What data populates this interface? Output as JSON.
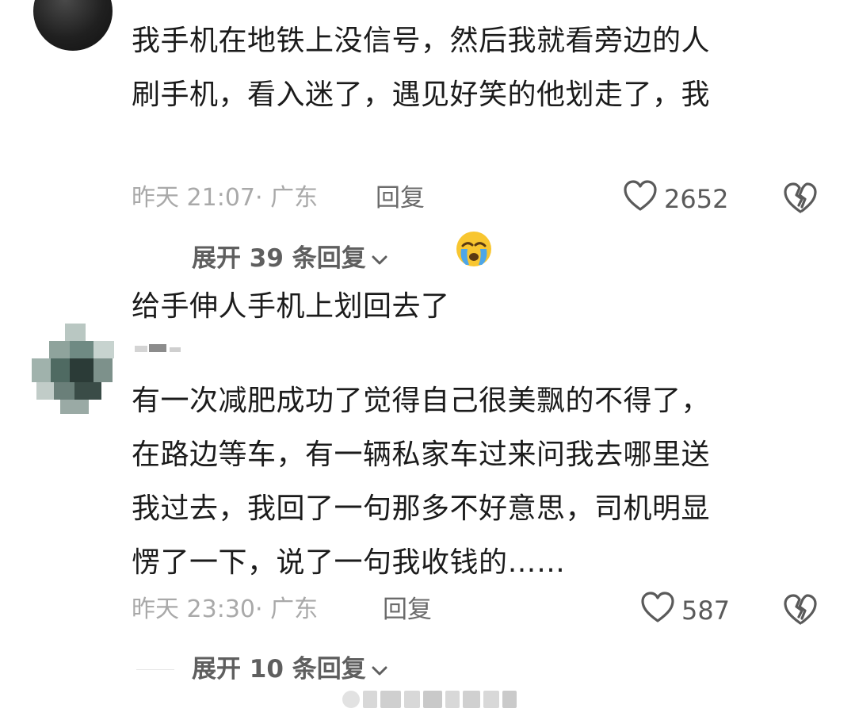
{
  "comments": [
    {
      "text": "我手机在地铁上没信号，然后我就看旁边的人\n刷手机，看入迷了，遇见好笑的他划走了，我\n给手伸人手机上划回去了",
      "emoji": "crying-face",
      "time": "昨天 21:07·",
      "location": "广东",
      "reply_label": "回复",
      "likes": "2652",
      "expand_label": "展开 39 条回复"
    },
    {
      "text": "有一次减肥成功了觉得自己很美飘的不得了，\n在路边等车，有一辆私家车过来问我去哪里送\n我过去，我回了一句那多不好意思，司机明显\n愣了一下，说了一句我收钱的……",
      "time": "昨天 23:30·",
      "location": "广东",
      "reply_label": "回复",
      "likes": "587",
      "expand_label": "展开 10 条回复"
    }
  ],
  "colors": {
    "text": "#1b1b1b",
    "meta": "#a9a9a9",
    "action": "#5a5a5a"
  }
}
